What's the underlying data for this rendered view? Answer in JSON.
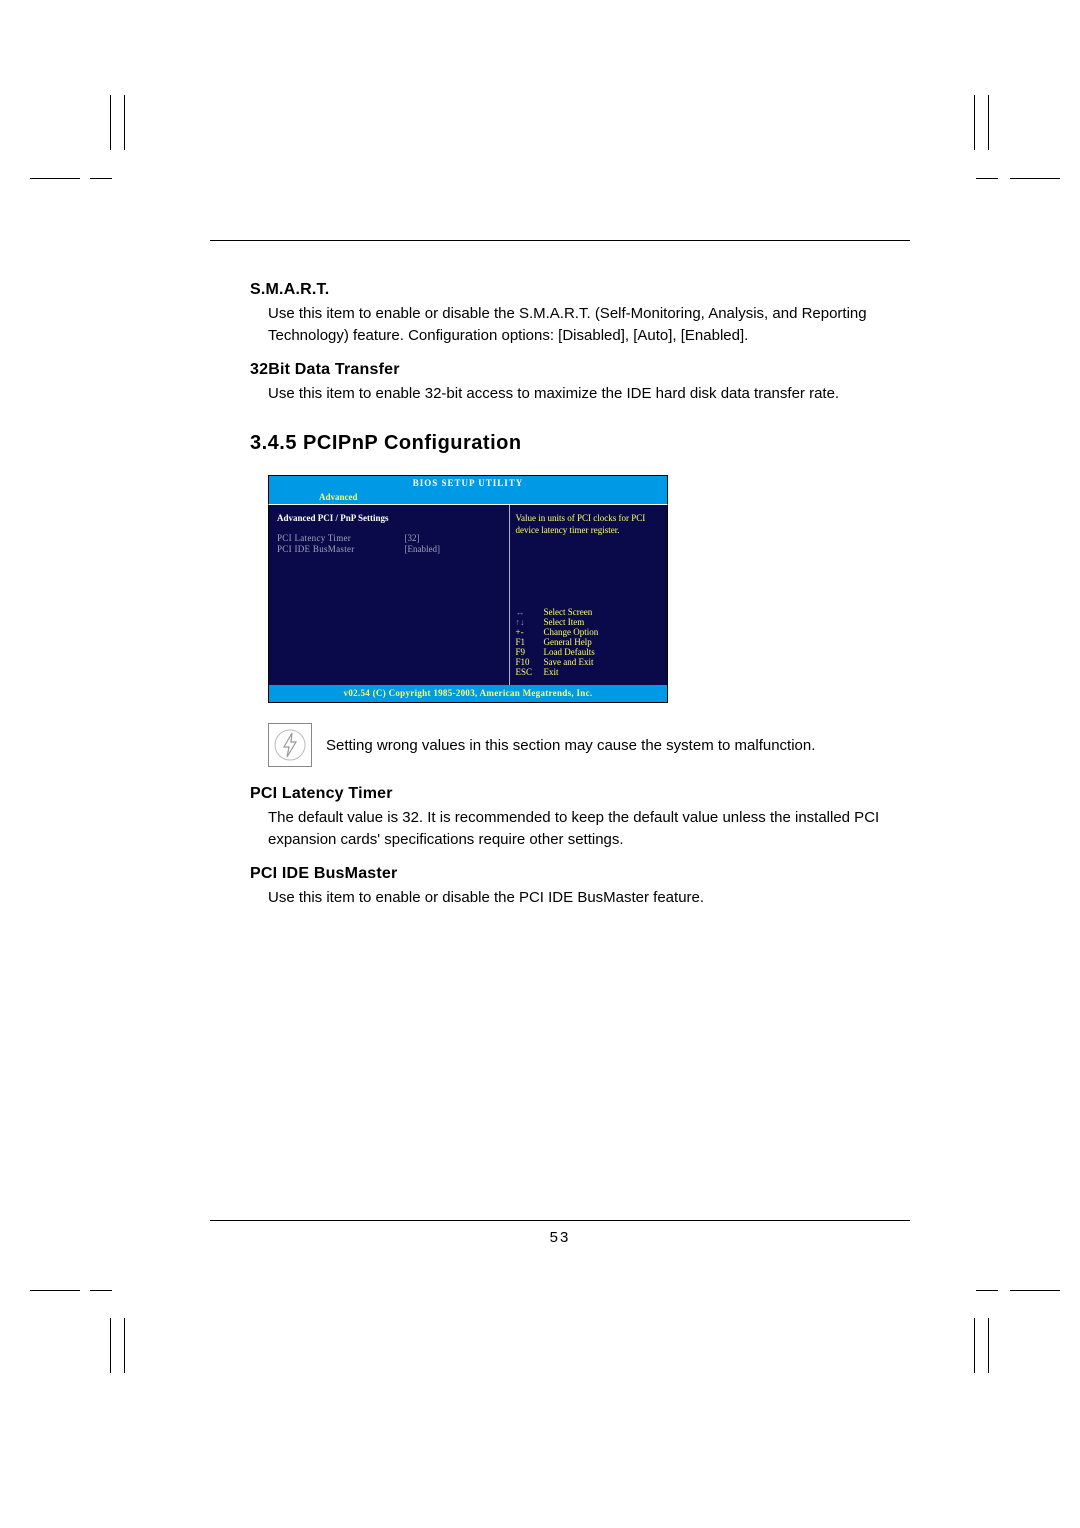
{
  "page_number": "53",
  "sections": {
    "smart": {
      "heading": "S.M.A.R.T.",
      "text": "Use this item to enable or disable the S.M.A.R.T. (Self-Monitoring, Analysis, and Reporting Technology) feature. Configuration options: [Disabled], [Auto], [Enabled]."
    },
    "bit32": {
      "heading": "32Bit Data Transfer",
      "text": "Use this item to enable 32-bit access to maximize the IDE hard disk data transfer rate."
    },
    "chapter": "3.4.5 PCIPnP Configuration",
    "warning": "Setting wrong values in this section may cause the system to malfunction.",
    "pci_latency": {
      "heading": "PCI Latency Timer",
      "text": "The default value is 32. It is recommended to keep the default value unless the installed PCI expansion cards' specifications require other settings."
    },
    "pci_ide": {
      "heading": "PCI IDE BusMaster",
      "text": "Use this item to enable or disable the PCI IDE BusMaster feature."
    }
  },
  "bios": {
    "title": "BIOS SETUP UTILITY",
    "tab": "Advanced",
    "panel_title": "Advanced PCI / PnP Settings",
    "settings": [
      {
        "label": "PCI Latency Timer",
        "value": "[32]"
      },
      {
        "label": "PCI IDE BusMaster",
        "value": "[Enabled]"
      }
    ],
    "help": "Value in units of PCI clocks for PCI device latency timer register.",
    "keys": [
      {
        "k": "↔",
        "d": "Select Screen",
        "arrow": true
      },
      {
        "k": "↑↓",
        "d": "Select Item",
        "arrow": true
      },
      {
        "k": "+-",
        "d": "Change Option"
      },
      {
        "k": "F1",
        "d": "General Help"
      },
      {
        "k": "F9",
        "d": "Load Defaults"
      },
      {
        "k": "F10",
        "d": "Save and Exit"
      },
      {
        "k": "ESC",
        "d": "Exit"
      }
    ],
    "footer": "v02.54 (C) Copyright 1985-2003, American Megatrends, Inc."
  }
}
